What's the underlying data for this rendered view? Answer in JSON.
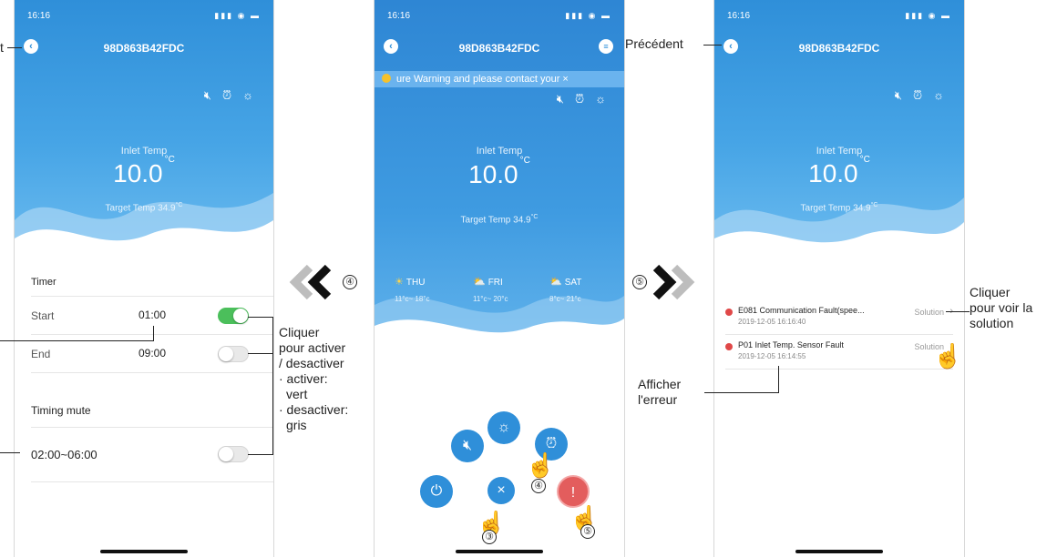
{
  "status_time": "16:16",
  "device_id": "98D863B42FDC",
  "inlet_label": "Inlet Temp",
  "inlet_value": "10.0",
  "temp_unit": "°C",
  "target_text": "Target Temp  34.9",
  "target_unit": "°C",
  "panel1": {
    "timer_title": "Timer",
    "start_label": "Start",
    "start_value": "01:00",
    "end_label": "End",
    "end_value": "09:00",
    "timing_mute_title": "Timing mute",
    "mute_range": "02:00~06:00",
    "left_ann_top": "t"
  },
  "panel2": {
    "warning_text": "ure Warning and please contact your ×",
    "forecast": [
      {
        "day": "THU",
        "range": "11°c~ 18°c",
        "icon": "sun-icon"
      },
      {
        "day": "FRI",
        "range": "11°c~ 20°c",
        "icon": "partly-cloudy-icon"
      },
      {
        "day": "SAT",
        "range": "8°c~ 21°c",
        "icon": "partly-cloudy-icon"
      }
    ]
  },
  "panel3": {
    "errors": [
      {
        "title": "E081 Communication Fault(spee...",
        "time": "2019-12-05 16:16:40",
        "action": "Solution"
      },
      {
        "title": "P01 Inlet Temp. Sensor Fault",
        "time": "2019-12-05 16:14:55",
        "action": "Solution"
      }
    ]
  },
  "annotations": {
    "precedent": "Précédent",
    "step4": "④",
    "step5": "⑤",
    "step3": "③",
    "toggle_note": [
      "Cliquer",
      "pour activer",
      "/ desactiver",
      "· activer:",
      "vert",
      "· desactiver:",
      "gris"
    ],
    "solution_note": [
      "Cliquer",
      "pour voir la",
      "solution"
    ],
    "error_note": [
      "Afficher",
      "l'erreur"
    ]
  },
  "colors": {
    "primary": "#2f8fd9",
    "toggle_on": "#4bbf5b",
    "error": "#e04848"
  }
}
